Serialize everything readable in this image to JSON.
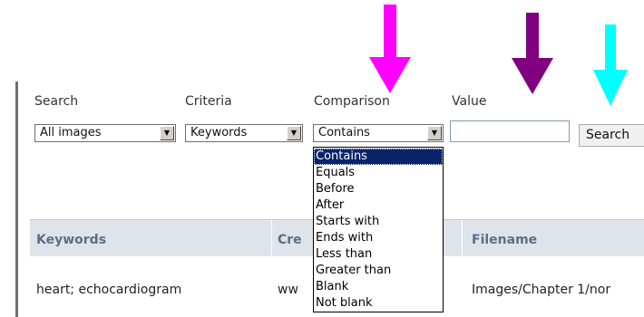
{
  "labels": {
    "search": "Search",
    "criteria": "Criteria",
    "comparison": "Comparison",
    "value": "Value"
  },
  "search_select": {
    "selected": "All images"
  },
  "criteria_select": {
    "selected": "Keywords"
  },
  "comparison_select": {
    "selected": "Contains",
    "options": [
      "Contains",
      "Equals",
      "Before",
      "After",
      "Starts with",
      "Ends with",
      "Less than",
      "Greater than",
      "Blank",
      "Not blank"
    ]
  },
  "value_input": {
    "value": "",
    "placeholder": ""
  },
  "search_button": {
    "label": "Search"
  },
  "table": {
    "headers": [
      "Keywords",
      "Cre",
      "Filename"
    ],
    "rows": [
      [
        "heart; echocardiogram",
        "ww",
        "Images/Chapter 1/nor"
      ]
    ]
  },
  "arrows": {
    "magenta": "#ff00ff",
    "purple": "#800080",
    "cyan": "#00ffff"
  }
}
